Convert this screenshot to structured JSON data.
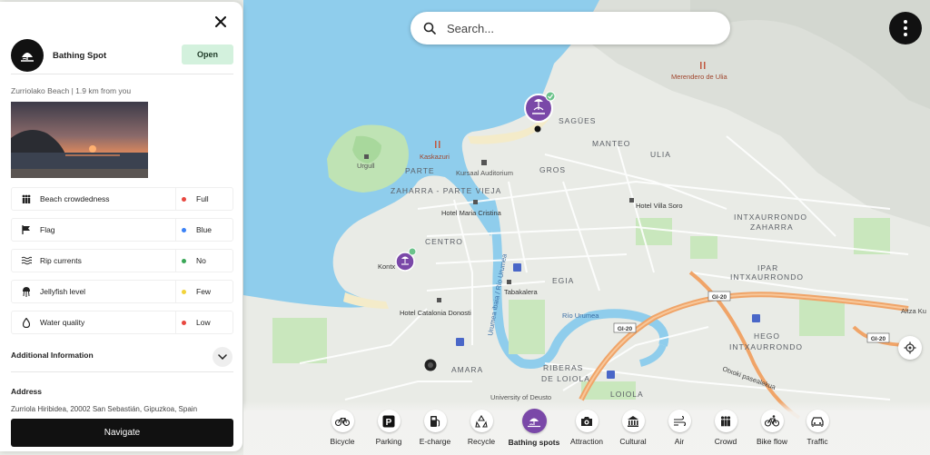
{
  "search": {
    "placeholder": "Search..."
  },
  "panel": {
    "title": "Bathing Spot",
    "status": "Open",
    "subtitle": "Zurriolako Beach | 1.9 km from you",
    "attributes": [
      {
        "label": "Beach crowdedness",
        "value": "Full",
        "dot_color": "#e8473f",
        "icon": "people-icon"
      },
      {
        "label": "Flag",
        "value": "Blue",
        "dot_color": "#3b82f6",
        "icon": "flag-icon"
      },
      {
        "label": "Rip currents",
        "value": "No",
        "dot_color": "#3aa757",
        "icon": "waves-icon"
      },
      {
        "label": "Jellyfish level",
        "value": "Few",
        "dot_color": "#f2d33a",
        "icon": "jellyfish-icon"
      },
      {
        "label": "Water quality",
        "value": "Low",
        "dot_color": "#e8473f",
        "icon": "droplet-icon"
      }
    ],
    "additional_info_label": "Additional Information",
    "address_label": "Address",
    "address": "Zurriola Hiribidea, 20002 San Sebastián, Gipuzkoa, Spain",
    "navigate_label": "Navigate"
  },
  "map": {
    "labels": [
      "SAGÜES",
      "MANTEO",
      "ULIA",
      "GROS",
      "PARTE",
      "ZAHARRA - PARTE VIEJA",
      "CENTRO",
      "EGIA",
      "INTXAURRONDO",
      "ZAHARRA",
      "IPAR",
      "INTXAURRONDO",
      "HEGO",
      "INTXAURRONDO",
      "RIBERAS",
      "DE LOIOLA",
      "AMARA",
      "LOIOLA"
    ],
    "pois": [
      "Merendero de Ulia",
      "Kaskazuri",
      "Kursaal Auditorium",
      "Urgull",
      "Hotel Maria Cristina",
      "Hotel Villa Soro",
      "Tabakalera",
      "Hotel Catalonia Donosti",
      "Otxoki pasealekua",
      "University of Deusto",
      "Kontx",
      "Río Urumea",
      "Urumea ibaia / Río Urumea",
      "Altza Ku"
    ],
    "road_badges": [
      "GI-20",
      "GI-20",
      "GI-20"
    ]
  },
  "categories": [
    {
      "label": "Bicycle",
      "icon": "bicycle-icon",
      "active": false
    },
    {
      "label": "Parking",
      "icon": "parking-icon",
      "active": false
    },
    {
      "label": "E-charge",
      "icon": "fuel-pump-icon",
      "active": false
    },
    {
      "label": "Recycle",
      "icon": "recycle-icon",
      "active": false
    },
    {
      "label": "Bathing spots",
      "icon": "beach-icon",
      "active": true
    },
    {
      "label": "Attraction",
      "icon": "camera-icon",
      "active": false
    },
    {
      "label": "Cultural",
      "icon": "museum-icon",
      "active": false
    },
    {
      "label": "Air",
      "icon": "wind-icon",
      "active": false
    },
    {
      "label": "Crowd",
      "icon": "crowd-icon",
      "active": false
    },
    {
      "label": "Bike flow",
      "icon": "bike-flow-icon",
      "active": false
    },
    {
      "label": "Traffic",
      "icon": "car-icon",
      "active": false
    }
  ],
  "colors": {
    "accent_purple": "#7a48a8",
    "status_open_bg": "#d3f1dd",
    "sea": "#8fcdec",
    "road_orange": "#f0a468"
  }
}
